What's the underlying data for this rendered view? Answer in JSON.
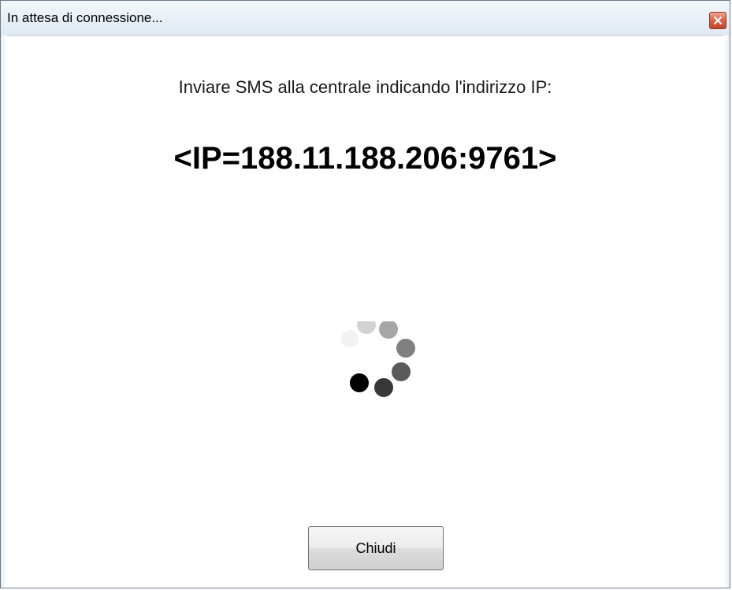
{
  "window": {
    "title": "In attesa di connessione..."
  },
  "dialog": {
    "instruction": "Inviare SMS alla centrale indicando l'indirizzo IP:",
    "ip_text": "<IP=188.11.188.206:9761>",
    "close_label": "Chiudi"
  },
  "icons": {
    "title_close": "close-icon",
    "spinner": "loading-spinner-icon"
  },
  "colors": {
    "close_button_red": "#c2452a",
    "text": "#000000"
  }
}
